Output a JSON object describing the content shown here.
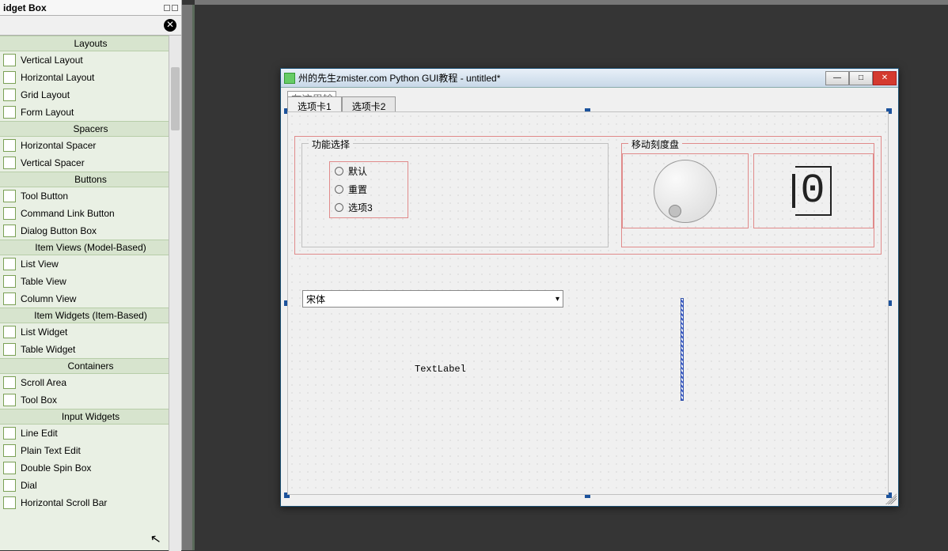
{
  "panel": {
    "title": "idget Box",
    "categories": [
      {
        "name": "Layouts",
        "items": [
          "Vertical Layout",
          "Horizontal Layout",
          "Grid Layout",
          "Form Layout"
        ]
      },
      {
        "name": "Spacers",
        "items": [
          "Horizontal Spacer",
          "Vertical Spacer"
        ]
      },
      {
        "name": "Buttons",
        "items": [
          "Tool Button",
          "Command Link Button",
          "Dialog Button Box"
        ]
      },
      {
        "name": "Item Views (Model-Based)",
        "items": [
          "List View",
          "Table View",
          "Column View"
        ]
      },
      {
        "name": "Item Widgets (Item-Based)",
        "items": [
          "List Widget",
          "Table Widget"
        ]
      },
      {
        "name": "Containers",
        "items": [
          "Scroll Area",
          "Tool Box"
        ]
      },
      {
        "name": "Input Widgets",
        "items": [
          "Line Edit",
          "Plain Text Edit",
          "Double Spin Box",
          "Dial",
          "Horizontal Scroll Bar"
        ]
      }
    ]
  },
  "form": {
    "title": "州的先生zmister.com Python GUI教程 - untitled*",
    "lineedit_placeholder": "在这里输入",
    "tabs": [
      "选项卡1",
      "选项卡2"
    ],
    "active_tab": 0,
    "group1": {
      "title": "功能选择",
      "radios": [
        "默认",
        "重置",
        "选项3"
      ]
    },
    "group2": {
      "title": "移动刻度盘",
      "lcd_value": "0"
    },
    "combo_value": "宋体",
    "textlabel": "TextLabel"
  }
}
